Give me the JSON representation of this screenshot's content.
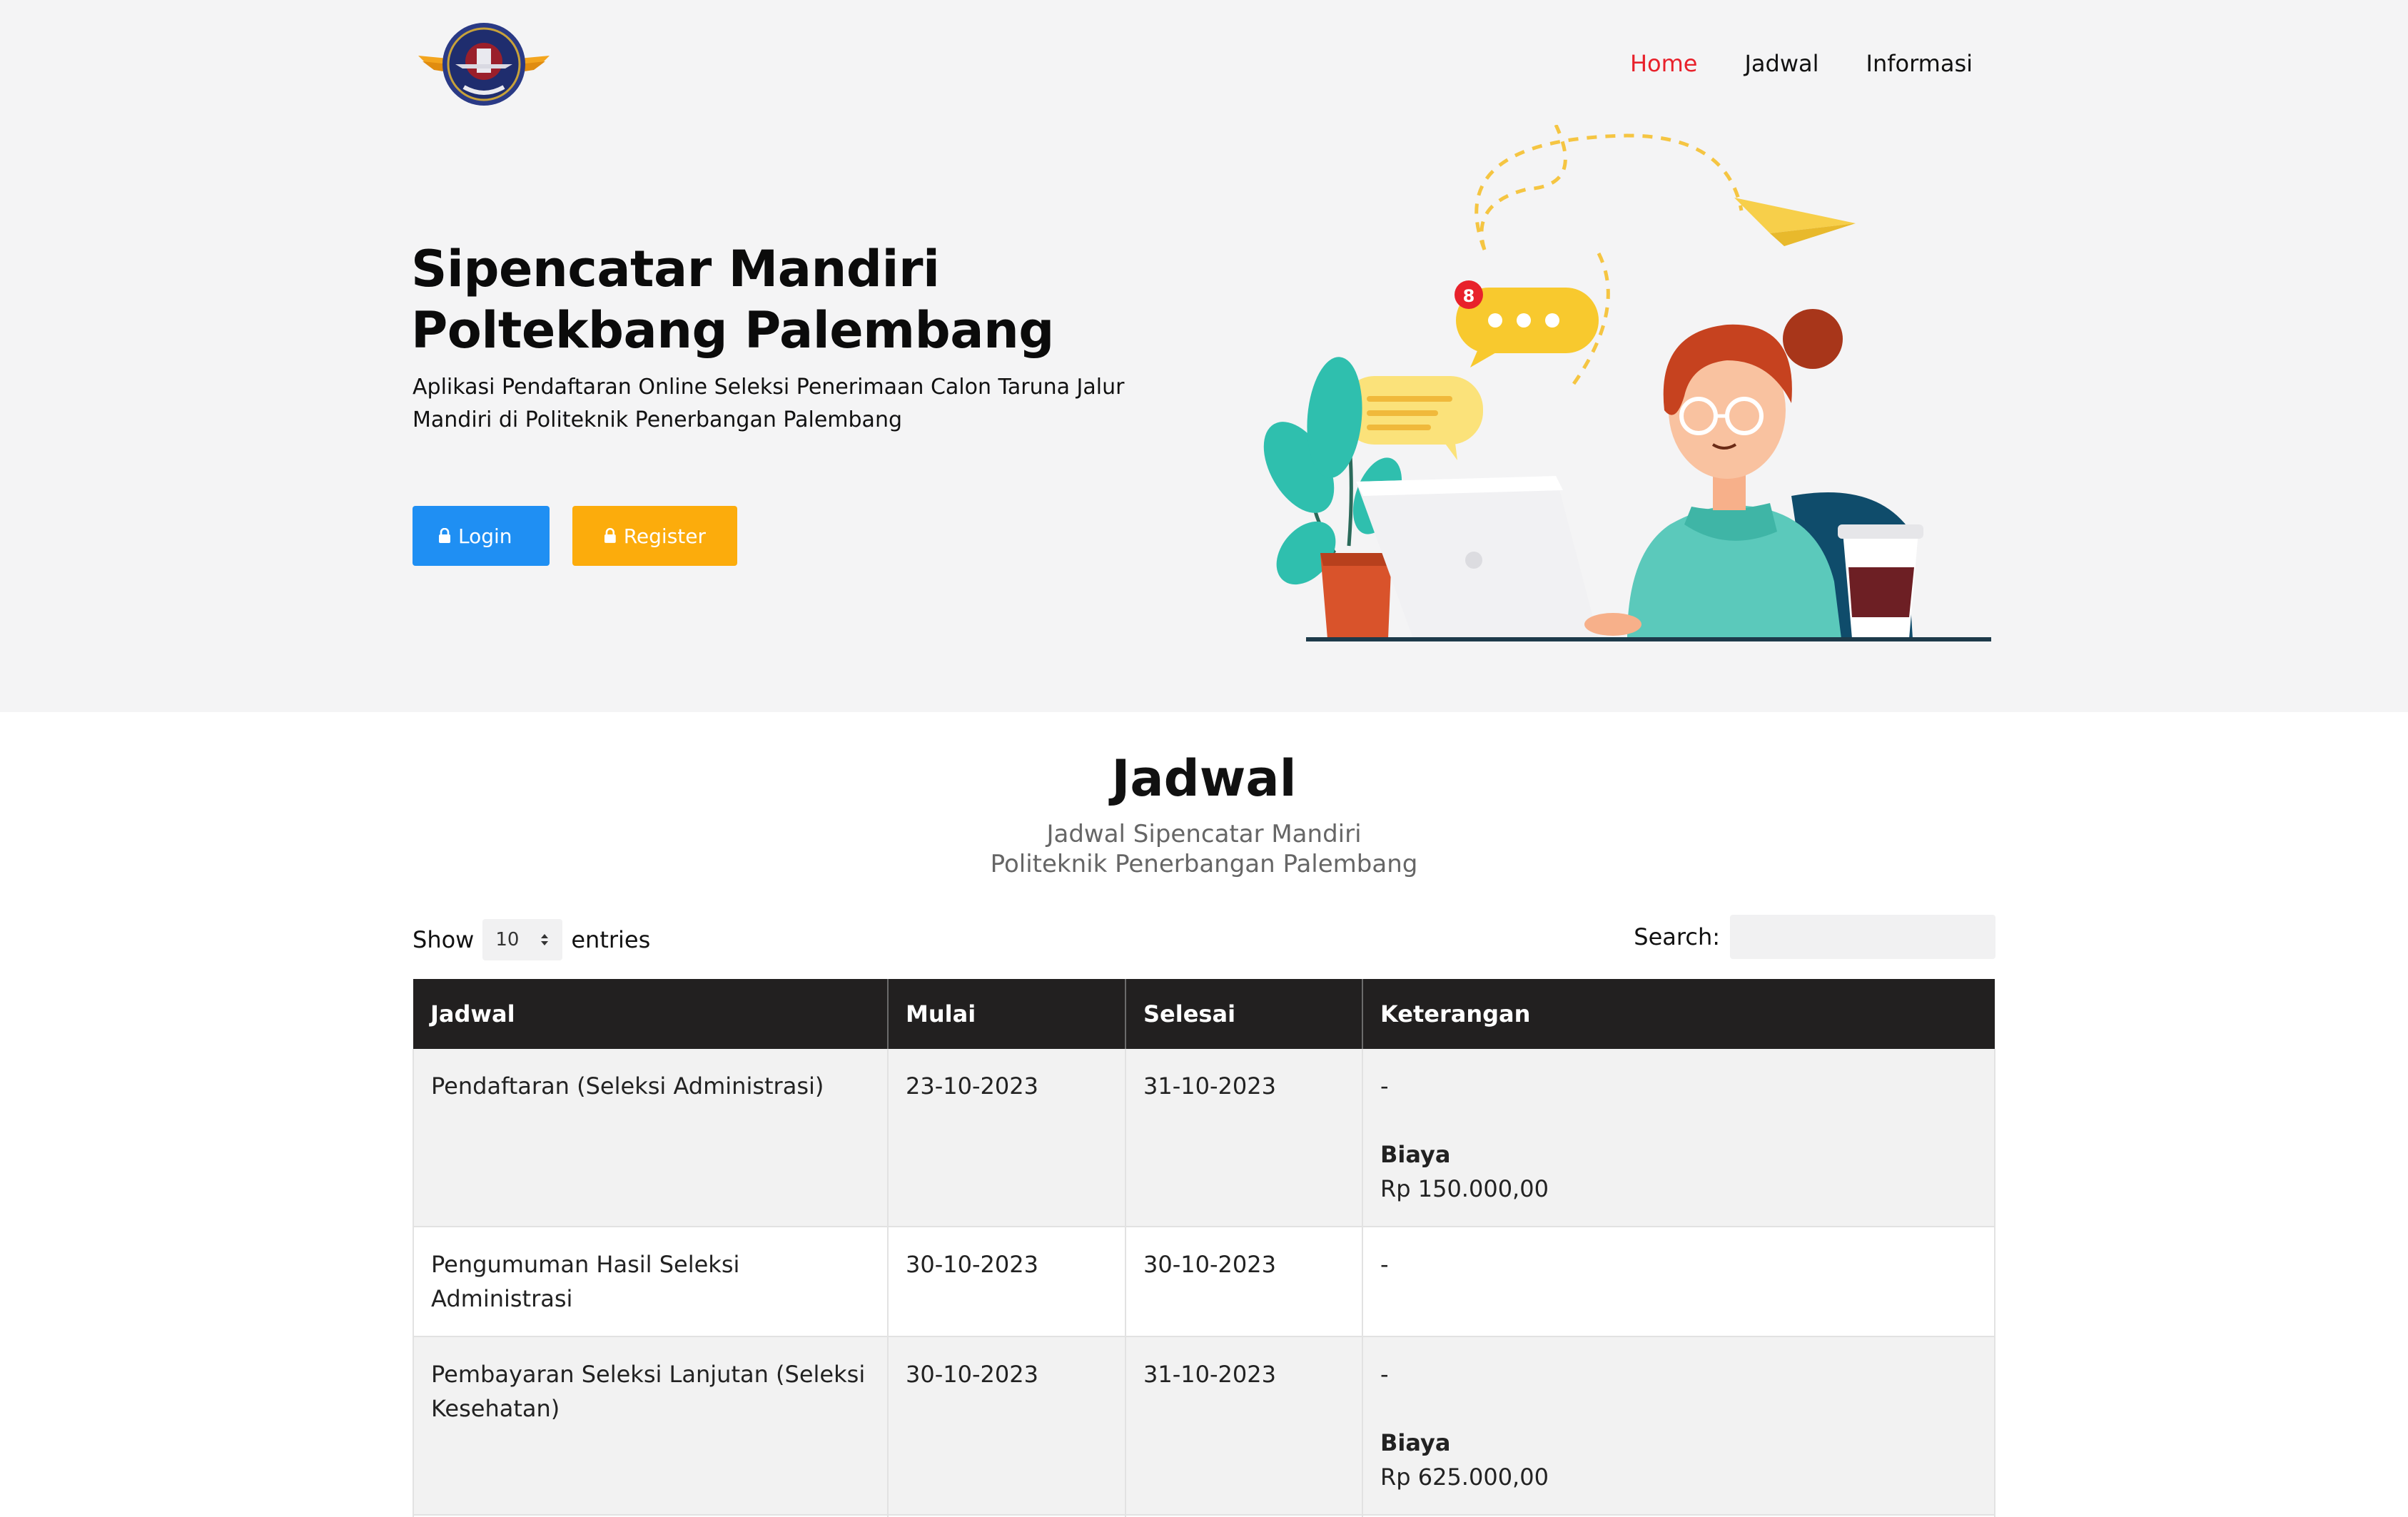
{
  "nav": {
    "home": "Home",
    "jadwal": "Jadwal",
    "informasi": "Informasi"
  },
  "hero": {
    "title_line1": "Sipencatar Mandiri",
    "title_line2": "Poltekbang Palembang",
    "description": "Aplikasi Pendaftaran Online Seleksi Penerimaan Calon Taruna Jalur Mandiri di Politeknik Penerbangan Palembang",
    "login_label": "Login",
    "register_label": "Register",
    "notification_count": "8"
  },
  "colors": {
    "accent_red": "#e8212b",
    "login_blue": "#1f8ff3",
    "register_orange": "#fcac0c",
    "table_header": "#222020"
  },
  "schedule": {
    "title": "Jadwal",
    "subtitle_line1": "Jadwal Sipencatar Mandiri",
    "subtitle_line2": "Politeknik Penerbangan Palembang",
    "show_label": "Show",
    "entries_value": "10",
    "entries_label": "entries",
    "search_label": "Search:",
    "search_value": "",
    "columns": [
      "Jadwal",
      "Mulai",
      "Selesai",
      "Keterangan"
    ],
    "rows": [
      {
        "jadwal": "Pendaftaran (Seleksi Administrasi)",
        "mulai": "23-10-2023",
        "selesai": "31-10-2023",
        "keterangan": "-",
        "biaya_label": "Biaya",
        "biaya": "Rp 150.000,00"
      },
      {
        "jadwal": "Pengumuman Hasil Seleksi Administrasi",
        "mulai": "30-10-2023",
        "selesai": "30-10-2023",
        "keterangan": "-"
      },
      {
        "jadwal": "Pembayaran Seleksi Lanjutan (Seleksi Kesehatan)",
        "mulai": "30-10-2023",
        "selesai": "31-10-2023",
        "keterangan": "-",
        "biaya_label": "Biaya",
        "biaya": "Rp 625.000,00"
      }
    ]
  }
}
